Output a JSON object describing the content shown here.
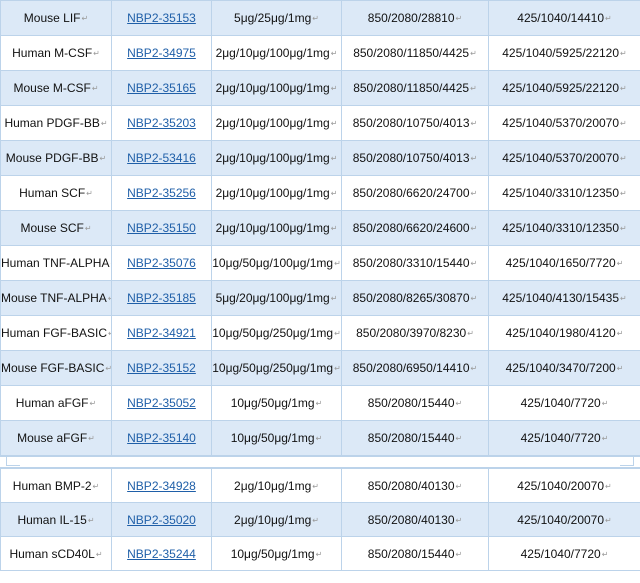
{
  "mark": "↵",
  "table_top": [
    {
      "name": "Mouse LIF",
      "code": "NBP2-35153",
      "sizes": "5μg/25μg/1mg",
      "price1": "850/2080/28810",
      "price2": "425/1040/14410",
      "shaded": true
    },
    {
      "name": "Human M-CSF",
      "code": "NBP2-34975",
      "sizes": "2μg/10μg/100μg/1mg",
      "price1": "850/2080/11850/4425",
      "price2": "425/1040/5925/22120",
      "shaded": false
    },
    {
      "name": "Mouse M-CSF",
      "code": "NBP2-35165",
      "sizes": "2μg/10μg/100μg/1mg",
      "price1": "850/2080/11850/4425",
      "price2": "425/1040/5925/22120",
      "shaded": true
    },
    {
      "name": "Human PDGF-BB",
      "code": "NBP2-35203",
      "sizes": "2μg/10μg/100μg/1mg",
      "price1": "850/2080/10750/4013",
      "price2": "425/1040/5370/20070",
      "shaded": false
    },
    {
      "name": "Mouse PDGF-BB",
      "code": "NBP2-53416",
      "sizes": "2μg/10μg/100μg/1mg",
      "price1": "850/2080/10750/4013",
      "price2": "425/1040/5370/20070",
      "shaded": true
    },
    {
      "name": "Human SCF",
      "code": "NBP2-35256",
      "sizes": "2μg/10μg/100μg/1mg",
      "price1": "850/2080/6620/24700",
      "price2": "425/1040/3310/12350",
      "shaded": false
    },
    {
      "name": "Mouse SCF",
      "code": "NBP2-35150",
      "sizes": "2μg/10μg/100μg/1mg",
      "price1": "850/2080/6620/24600",
      "price2": "425/1040/3310/12350",
      "shaded": true
    },
    {
      "name": "Human TNF-ALPHA",
      "code": "NBP2-35076",
      "sizes": "10μg/50μg/100μg/1mg",
      "price1": "850/2080/3310/15440",
      "price2": "425/1040/1650/7720",
      "shaded": false
    },
    {
      "name": "Mouse TNF-ALPHA",
      "code": "NBP2-35185",
      "sizes": "5μg/20μg/100μg/1mg",
      "price1": "850/2080/8265/30870",
      "price2": "425/1040/4130/15435",
      "shaded": true
    },
    {
      "name": "Human FGF-BASIC",
      "code": "NBP2-34921",
      "sizes": "10μg/50μg/250μg/1mg",
      "price1": "850/2080/3970/8230",
      "price2": "425/1040/1980/4120",
      "shaded": false
    },
    {
      "name": "Mouse FGF-BASIC",
      "code": "NBP2-35152",
      "sizes": "10μg/50μg/250μg/1mg",
      "price1": "850/2080/6950/14410",
      "price2": "425/1040/3470/7200",
      "shaded": true
    },
    {
      "name": "Human aFGF",
      "code": "NBP2-35052",
      "sizes": "10μg/50μg/1mg",
      "price1": "850/2080/15440",
      "price2": "425/1040/7720",
      "shaded": false
    },
    {
      "name": "Mouse aFGF",
      "code": "NBP2-35140",
      "sizes": "10μg/50μg/1mg",
      "price1": "850/2080/15440",
      "price2": "425/1040/7720",
      "shaded": true
    }
  ],
  "table_bottom": [
    {
      "name": "Human BMP-2",
      "code": "NBP2-34928",
      "sizes": "2μg/10μg/1mg",
      "price1": "850/2080/40130",
      "price2": "425/1040/20070",
      "shaded": false
    },
    {
      "name": "Human IL-15",
      "code": "NBP2-35020",
      "sizes": "2μg/10μg/1mg",
      "price1": "850/2080/40130",
      "price2": "425/1040/20070",
      "shaded": true
    },
    {
      "name": "Human sCD40L",
      "code": "NBP2-35244",
      "sizes": "10μg/50μg/1mg",
      "price1": "850/2080/15440",
      "price2": "425/1040/7720",
      "shaded": false
    }
  ]
}
